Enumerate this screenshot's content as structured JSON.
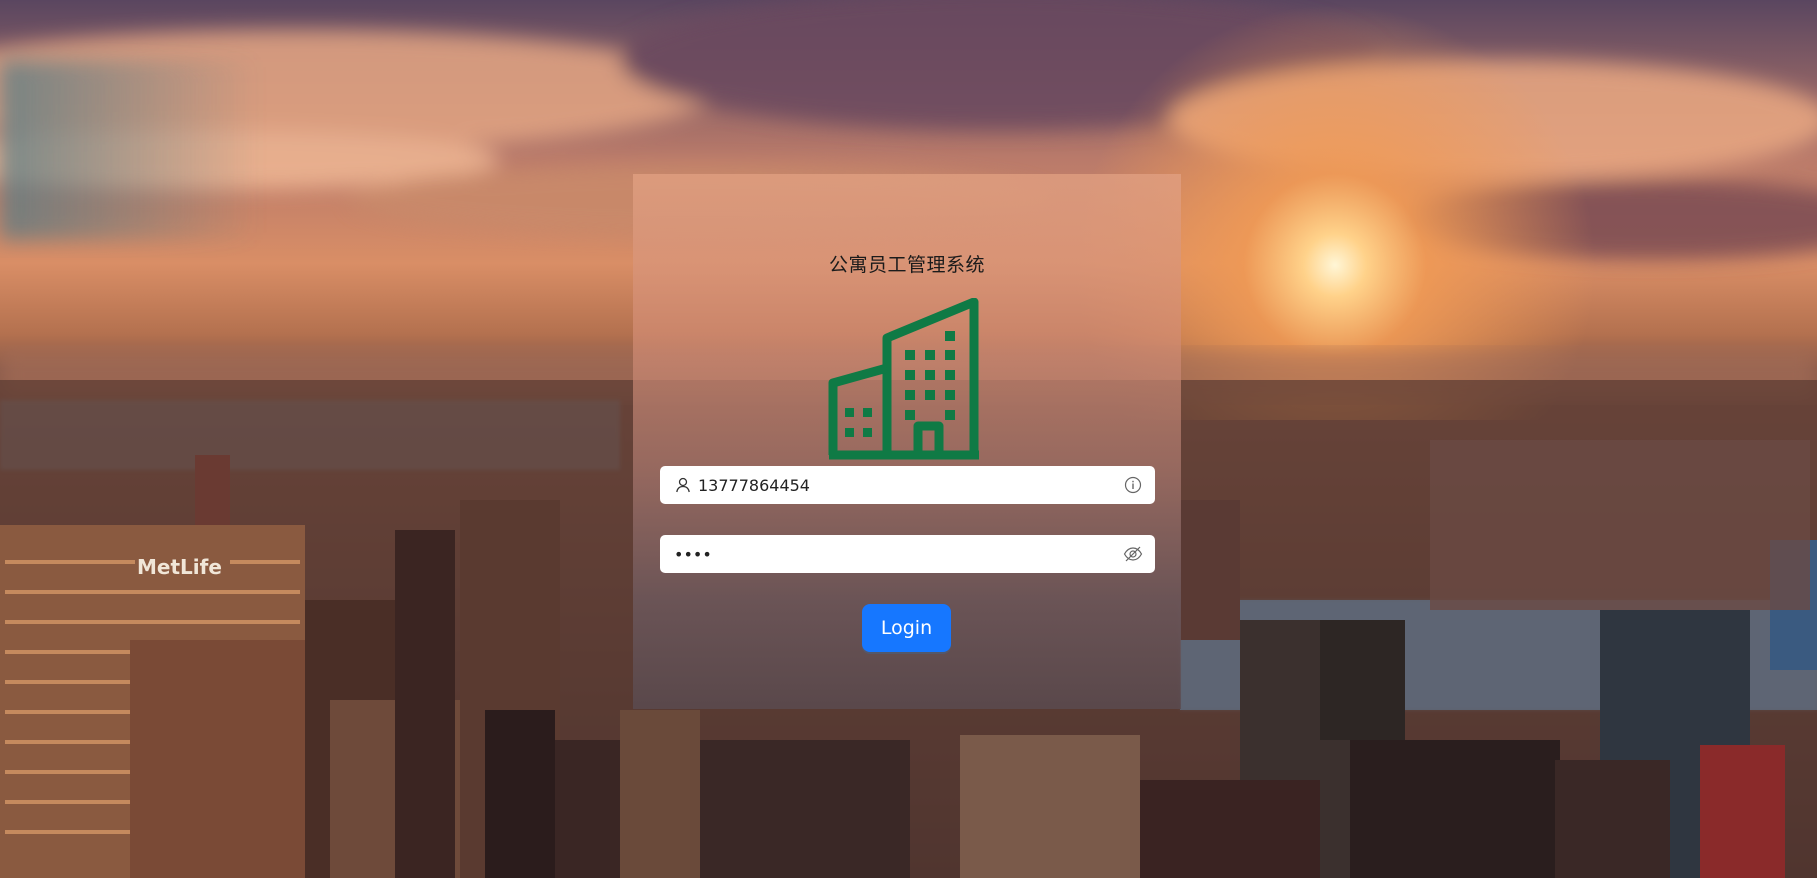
{
  "app": {
    "title": "公寓员工管理系统"
  },
  "login_form": {
    "username": {
      "value": "13777864454",
      "prefix_icon": "user-icon",
      "suffix_icon": "info-circle-icon"
    },
    "password": {
      "value": "1234",
      "prefix_icon": "",
      "suffix_icon": "eye-invisible-icon"
    },
    "submit_label": "Login"
  },
  "logo": {
    "icon": "building-icon",
    "color": "#0f7a45"
  },
  "colors": {
    "primary": "#1677ff",
    "logo_green": "#0f7a45"
  }
}
